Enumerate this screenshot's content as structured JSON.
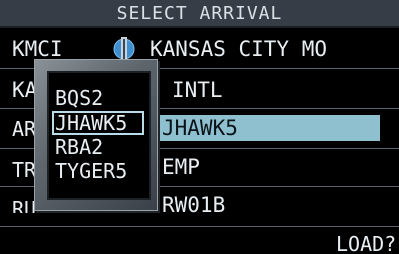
{
  "title": "SELECT ARRIVAL",
  "airport": {
    "ident": "KMCI",
    "city": "KANSAS CITY MO",
    "name_partial_left": "KA",
    "name_right": "INTL",
    "icon": "airport-runway-icon"
  },
  "fields": {
    "arrival_label": "AR",
    "arrival_value": "JHAWK5",
    "transition_label": "TR",
    "transition_value": "EMP",
    "runway_label": "RU",
    "runway_value": "RW01B"
  },
  "popup": {
    "items": [
      "BQS2",
      "JHAWK5",
      "RBA2",
      "TYGER5"
    ],
    "selected": "JHAWK5"
  },
  "load_prompt": "LOAD?",
  "colors": {
    "background": "#000000",
    "title_bar": "#363d47",
    "highlight": "#8fc0cf",
    "text": "#e8eef2"
  }
}
